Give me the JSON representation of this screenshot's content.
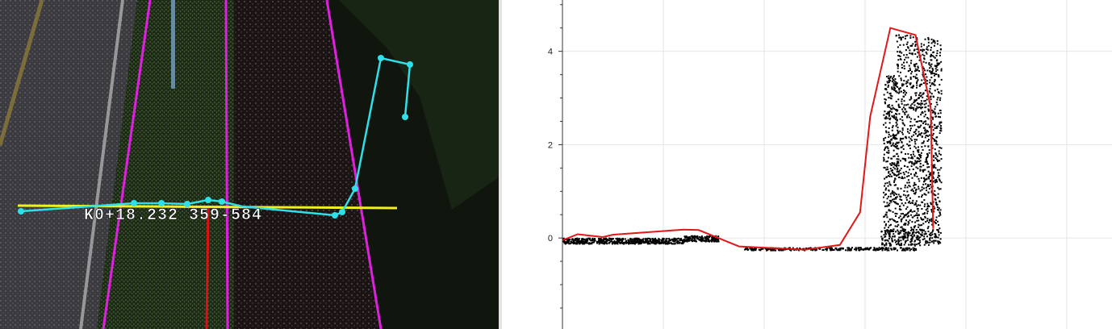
{
  "left_view": {
    "station_label": "K0+18.232 359-584",
    "colors": {
      "boundary_line": "#e020e0",
      "section_line": "#f0f020",
      "profile_polyline": "#30e0e8",
      "center_line": "#e01010"
    }
  },
  "right_view": {
    "y_tick_labels": [
      "4",
      "2",
      "0"
    ],
    "colors": {
      "profile_line": "#e01818",
      "points": "#000000",
      "grid": "#e6e6e6"
    }
  },
  "chart_data": {
    "type": "scatter",
    "title": "",
    "xlabel": "",
    "ylabel": "",
    "ylim": [
      -1.95,
      5.1
    ],
    "xlim": [
      0,
      100
    ],
    "y_ticks": [
      4,
      2,
      0
    ],
    "grid": true,
    "series": [
      {
        "values_x": [
          0,
          3,
          8,
          10,
          24,
          27,
          35,
          48,
          55,
          59,
          61,
          65,
          70,
          73,
          73.5
        ],
        "values_y": [
          -0.05,
          0.08,
          0.02,
          0.07,
          0.18,
          0.17,
          -0.18,
          -0.25,
          -0.15,
          0.55,
          2.6,
          4.5,
          4.35,
          2.8,
          0.2
        ]
      }
    ]
  }
}
